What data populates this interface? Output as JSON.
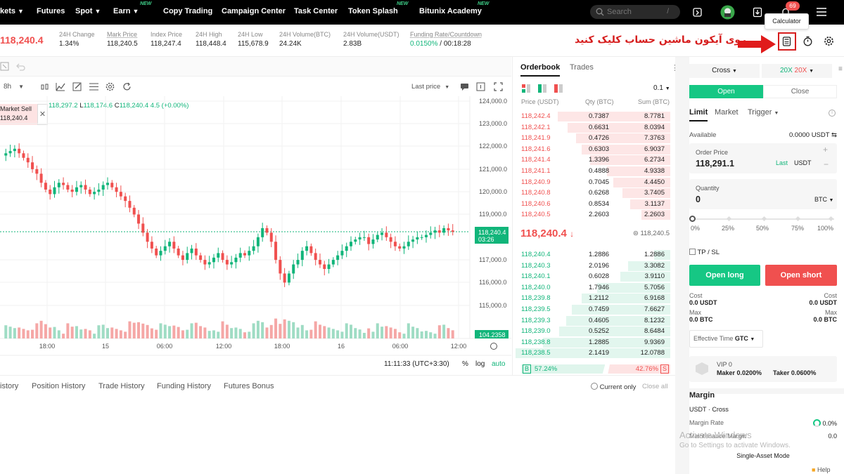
{
  "nav": {
    "items": [
      {
        "label": "kets",
        "caret": true
      },
      {
        "label": "Futures",
        "caret": false
      },
      {
        "label": "Spot",
        "caret": true
      },
      {
        "label": "Earn",
        "caret": true,
        "badge": "NEW"
      },
      {
        "label": "Copy Trading",
        "caret": false
      },
      {
        "label": "Campaign Center",
        "caret": false
      },
      {
        "label": "Task Center",
        "caret": false
      },
      {
        "label": "Token Splash",
        "caret": false,
        "badge": "NEW"
      },
      {
        "label": "Bitunix Academy",
        "caret": false,
        "badge": "NEW"
      }
    ],
    "search_placeholder": "Search",
    "search_shortcut": "/",
    "notification_count": "69",
    "tooltip": "Calculator"
  },
  "ticker": {
    "last_price": "118,240.4",
    "stats": [
      {
        "label": "24H Change",
        "value": "1.34%",
        "color": "green"
      },
      {
        "label": "Mark Price",
        "value": "118,240.5"
      },
      {
        "label": "Index Price",
        "value": "118,247.4"
      },
      {
        "label": "24H High",
        "value": "118,448.4"
      },
      {
        "label": "24H Low",
        "value": "115,678.9"
      },
      {
        "label": "24H Volume(BTC)",
        "value": "24.24K"
      },
      {
        "label": "24H Volume(USDT)",
        "value": "2.83B"
      }
    ],
    "funding_label": "Funding Rate/Countdown",
    "funding_rate": "0.0150%",
    "funding_countdown": "/ 00:18:28"
  },
  "annotation": "روی آیکون ماشین حساب کلیک کنید",
  "chart": {
    "interval": "8h",
    "last_price_mode": "Last price",
    "market_sell_label": "Market Sell",
    "market_sell_price": "118,240.4",
    "ohlc": {
      "o": "118,297.2",
      "l": "118,174.6",
      "c": "118,240.4",
      "chg": "4.5 (+0.00%)"
    },
    "price_ticks": [
      "124,000.0",
      "123,000.0",
      "122,000.0",
      "121,000.0",
      "120,000.0",
      "119,000.0",
      "117,000.0",
      "116,000.0",
      "115,000.0"
    ],
    "time_ticks": [
      "18:00",
      "15",
      "06:00",
      "12:00",
      "18:00",
      "16",
      "06:00",
      "12:00"
    ],
    "current_price": "118,240.4",
    "countdown": "03:26",
    "volume_label": "104.2358",
    "clock": "11:11:33 (UTC+3:30)",
    "scale_buttons": [
      "%",
      "log",
      "auto"
    ]
  },
  "orderbook": {
    "tabs": [
      "Orderbook",
      "Trades"
    ],
    "precision": "0.1",
    "headers": [
      "Price (USDT)",
      "Qty (BTC)",
      "Sum (BTC)"
    ],
    "asks": [
      [
        "118,242.4",
        "0.7387",
        "8.7781"
      ],
      [
        "118,242.1",
        "0.6631",
        "8.0394"
      ],
      [
        "118,241.9",
        "0.4726",
        "7.3763"
      ],
      [
        "118,241.6",
        "0.6303",
        "6.9037"
      ],
      [
        "118,241.4",
        "1.3396",
        "6.2734"
      ],
      [
        "118,241.1",
        "0.4888",
        "4.9338"
      ],
      [
        "118,240.9",
        "0.7045",
        "4.4450"
      ],
      [
        "118,240.8",
        "0.6268",
        "3.7405"
      ],
      [
        "118,240.6",
        "0.8534",
        "3.1137"
      ],
      [
        "118,240.5",
        "2.2603",
        "2.2603"
      ]
    ],
    "last_price": "118,240.4",
    "mark_price": "118,240.5",
    "bids": [
      [
        "118,240.4",
        "1.2886",
        "1.2886"
      ],
      [
        "118,240.3",
        "2.0196",
        "3.3082"
      ],
      [
        "118,240.1",
        "0.6028",
        "3.9110"
      ],
      [
        "118,240.0",
        "1.7946",
        "5.7056"
      ],
      [
        "118,239.8",
        "1.2112",
        "6.9168"
      ],
      [
        "118,239.5",
        "0.7459",
        "7.6627"
      ],
      [
        "118,239.3",
        "0.4605",
        "8.1232"
      ],
      [
        "118,239.0",
        "0.5252",
        "8.6484"
      ],
      [
        "118,238.8",
        "1.2885",
        "9.9369"
      ],
      [
        "118,238.5",
        "2.1419",
        "12.0788"
      ]
    ],
    "buy_label": "B",
    "buy_ratio": "57.24%",
    "sell_ratio": "42.76%",
    "sell_label": "S"
  },
  "order": {
    "margin_mode": "Cross",
    "leverage_long": "20X",
    "leverage_short": "20X",
    "open_tab": "Open",
    "close_tab": "Close",
    "types": [
      "Limit",
      "Market",
      "Trigger"
    ],
    "available_label": "Available",
    "available_value": "0.0000 USDT",
    "order_price_label": "Order Price",
    "order_price": "118,291.1",
    "last_label": "Last",
    "price_unit": "USDT",
    "quantity_label": "Quantity",
    "quantity": "0",
    "qty_unit": "BTC",
    "slider_marks": [
      "0%",
      "25%",
      "50%",
      "75%",
      "100%"
    ],
    "tpsl_label": "TP / SL",
    "open_long": "Open long",
    "open_short": "Open short",
    "cost_label": "Cost",
    "cost_long": "0.0 USDT",
    "cost_short": "0.0 USDT",
    "max_label": "Max",
    "max_long": "0.0 BTC",
    "max_short": "0.0 BTC",
    "effective_label": "Effective Time",
    "effective_value": "GTC",
    "vip": "VIP 0",
    "maker": "Maker 0.0200%",
    "taker": "Taker 0.0600%",
    "margin_title": "Margin",
    "margin_asset": "USDT · Cross",
    "margin_rate_label": "Margin Rate",
    "margin_rate": "0.0%",
    "maintenance_label": "Maintenance Margin",
    "maintenance_value": "0.0",
    "single_asset": "Single-Asset Mode",
    "help": "Help"
  },
  "bottom": {
    "tabs": [
      "istory",
      "Position History",
      "Trade History",
      "Funding History",
      "Futures Bonus"
    ],
    "current_only": "Current only",
    "close_all": "Close all"
  },
  "watermark": {
    "line1": "Activate Windows",
    "line2": "Go to Settings to activate Windows."
  },
  "colors": {
    "up": "#11b57a",
    "down": "#f0504f",
    "accent": "#16c784",
    "short_button": "#f0504f"
  }
}
